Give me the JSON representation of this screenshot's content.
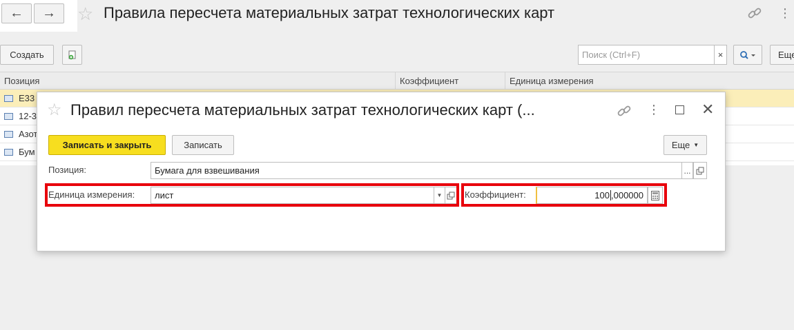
{
  "window": {
    "title": "Правила пересчета материальных затрат технологических карт"
  },
  "toolbar": {
    "create_label": "Создать",
    "search_placeholder": "Поиск (Ctrl+F)",
    "search_clear": "×",
    "more_label": "Еще"
  },
  "list": {
    "columns": [
      "Позиция",
      "Коэффициент",
      "Единица измерения"
    ],
    "rows": [
      {
        "position": "E33",
        "selected": true
      },
      {
        "position": "12-3",
        "selected": false
      },
      {
        "position": "Азот",
        "selected": false
      },
      {
        "position": "Бум",
        "selected": false
      }
    ]
  },
  "dialog": {
    "title": "Правил пересчета материальных затрат технологических карт (...",
    "save_close_label": "Записать и закрыть",
    "save_label": "Записать",
    "more_label": "Еще",
    "position_label": "Позиция:",
    "position_value": "Бумага для взвешивания",
    "position_select": "...",
    "unit_label": "Единица измерения:",
    "unit_value": "лист",
    "coef_label": "Коэффициент:",
    "coef_value_int": "100",
    "coef_value_frac": ",000000"
  },
  "colors": {
    "accent_yellow": "#f7de1f",
    "highlight_red": "#e8000b",
    "selected_row": "#fbeeb9"
  }
}
